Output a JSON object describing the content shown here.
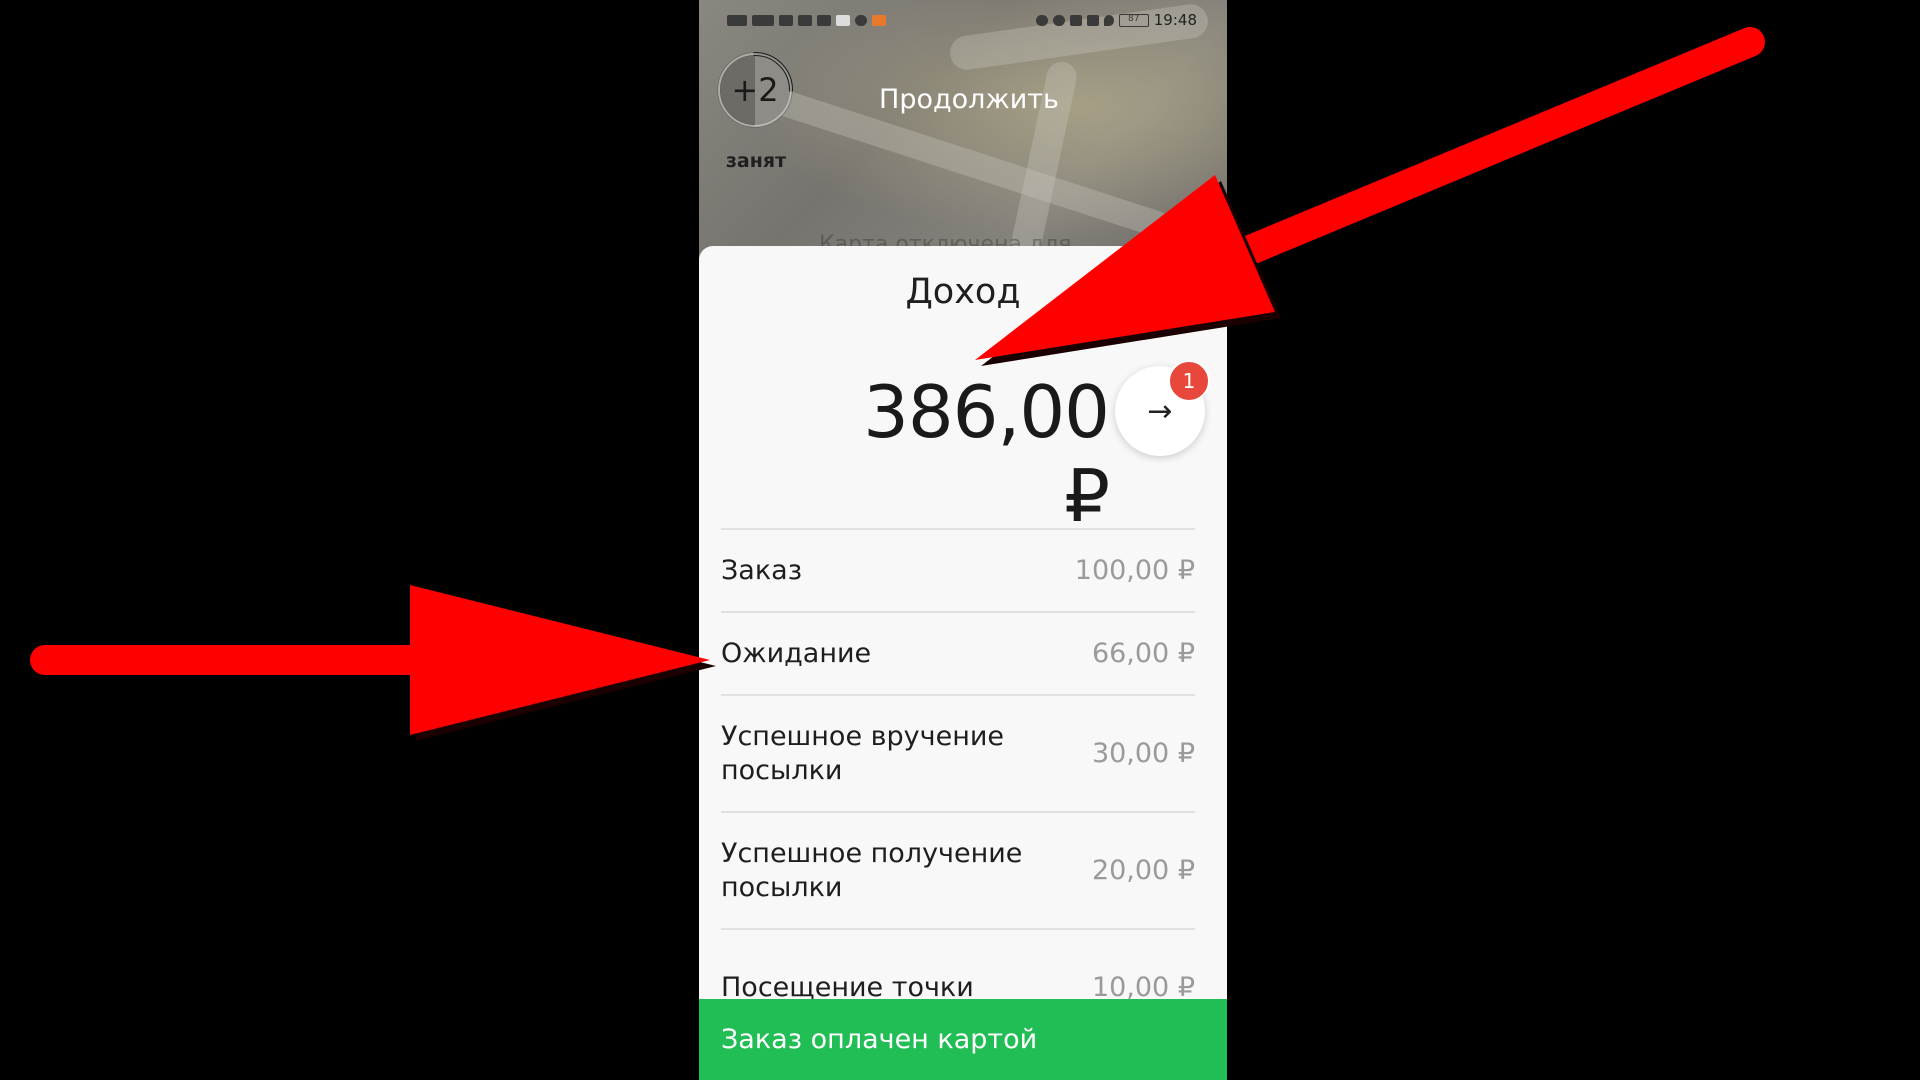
{
  "status_bar": {
    "time": "19:48",
    "left_icons": [
      "network-icon",
      "4g-icon",
      "signal-icon",
      "youtube-icon",
      "video-icon",
      "gallery-icon",
      "info-icon",
      "app-icon"
    ],
    "right_icons": [
      "headphones-icon",
      "alarm-icon",
      "bluetooth-icon",
      "vibrate-icon",
      "location-icon",
      "battery-icon"
    ],
    "battery": "87"
  },
  "header": {
    "busy_count": "+2",
    "busy_label": "занят",
    "continue_label": "Продолжить",
    "hidden_text": "Карта отключена для"
  },
  "income": {
    "title": "Доход",
    "total": "386,00 ₽",
    "badge_count": "1",
    "rows": [
      {
        "label": "Заказ",
        "value": "100,00 ₽"
      },
      {
        "label": "Ожидание",
        "value": "66,00 ₽"
      },
      {
        "label": "Успешное вручение посылки",
        "value": "30,00 ₽"
      },
      {
        "label": "Успешное получение посылки",
        "value": "20,00 ₽"
      },
      {
        "label": "Посещение точки",
        "value": "10,00 ₽"
      }
    ]
  },
  "payment_bar": {
    "label": "Заказ оплачен картой"
  },
  "colors": {
    "accent_green": "#21bd55",
    "badge_red": "#e8473c",
    "annotation_red": "#ff0000"
  }
}
